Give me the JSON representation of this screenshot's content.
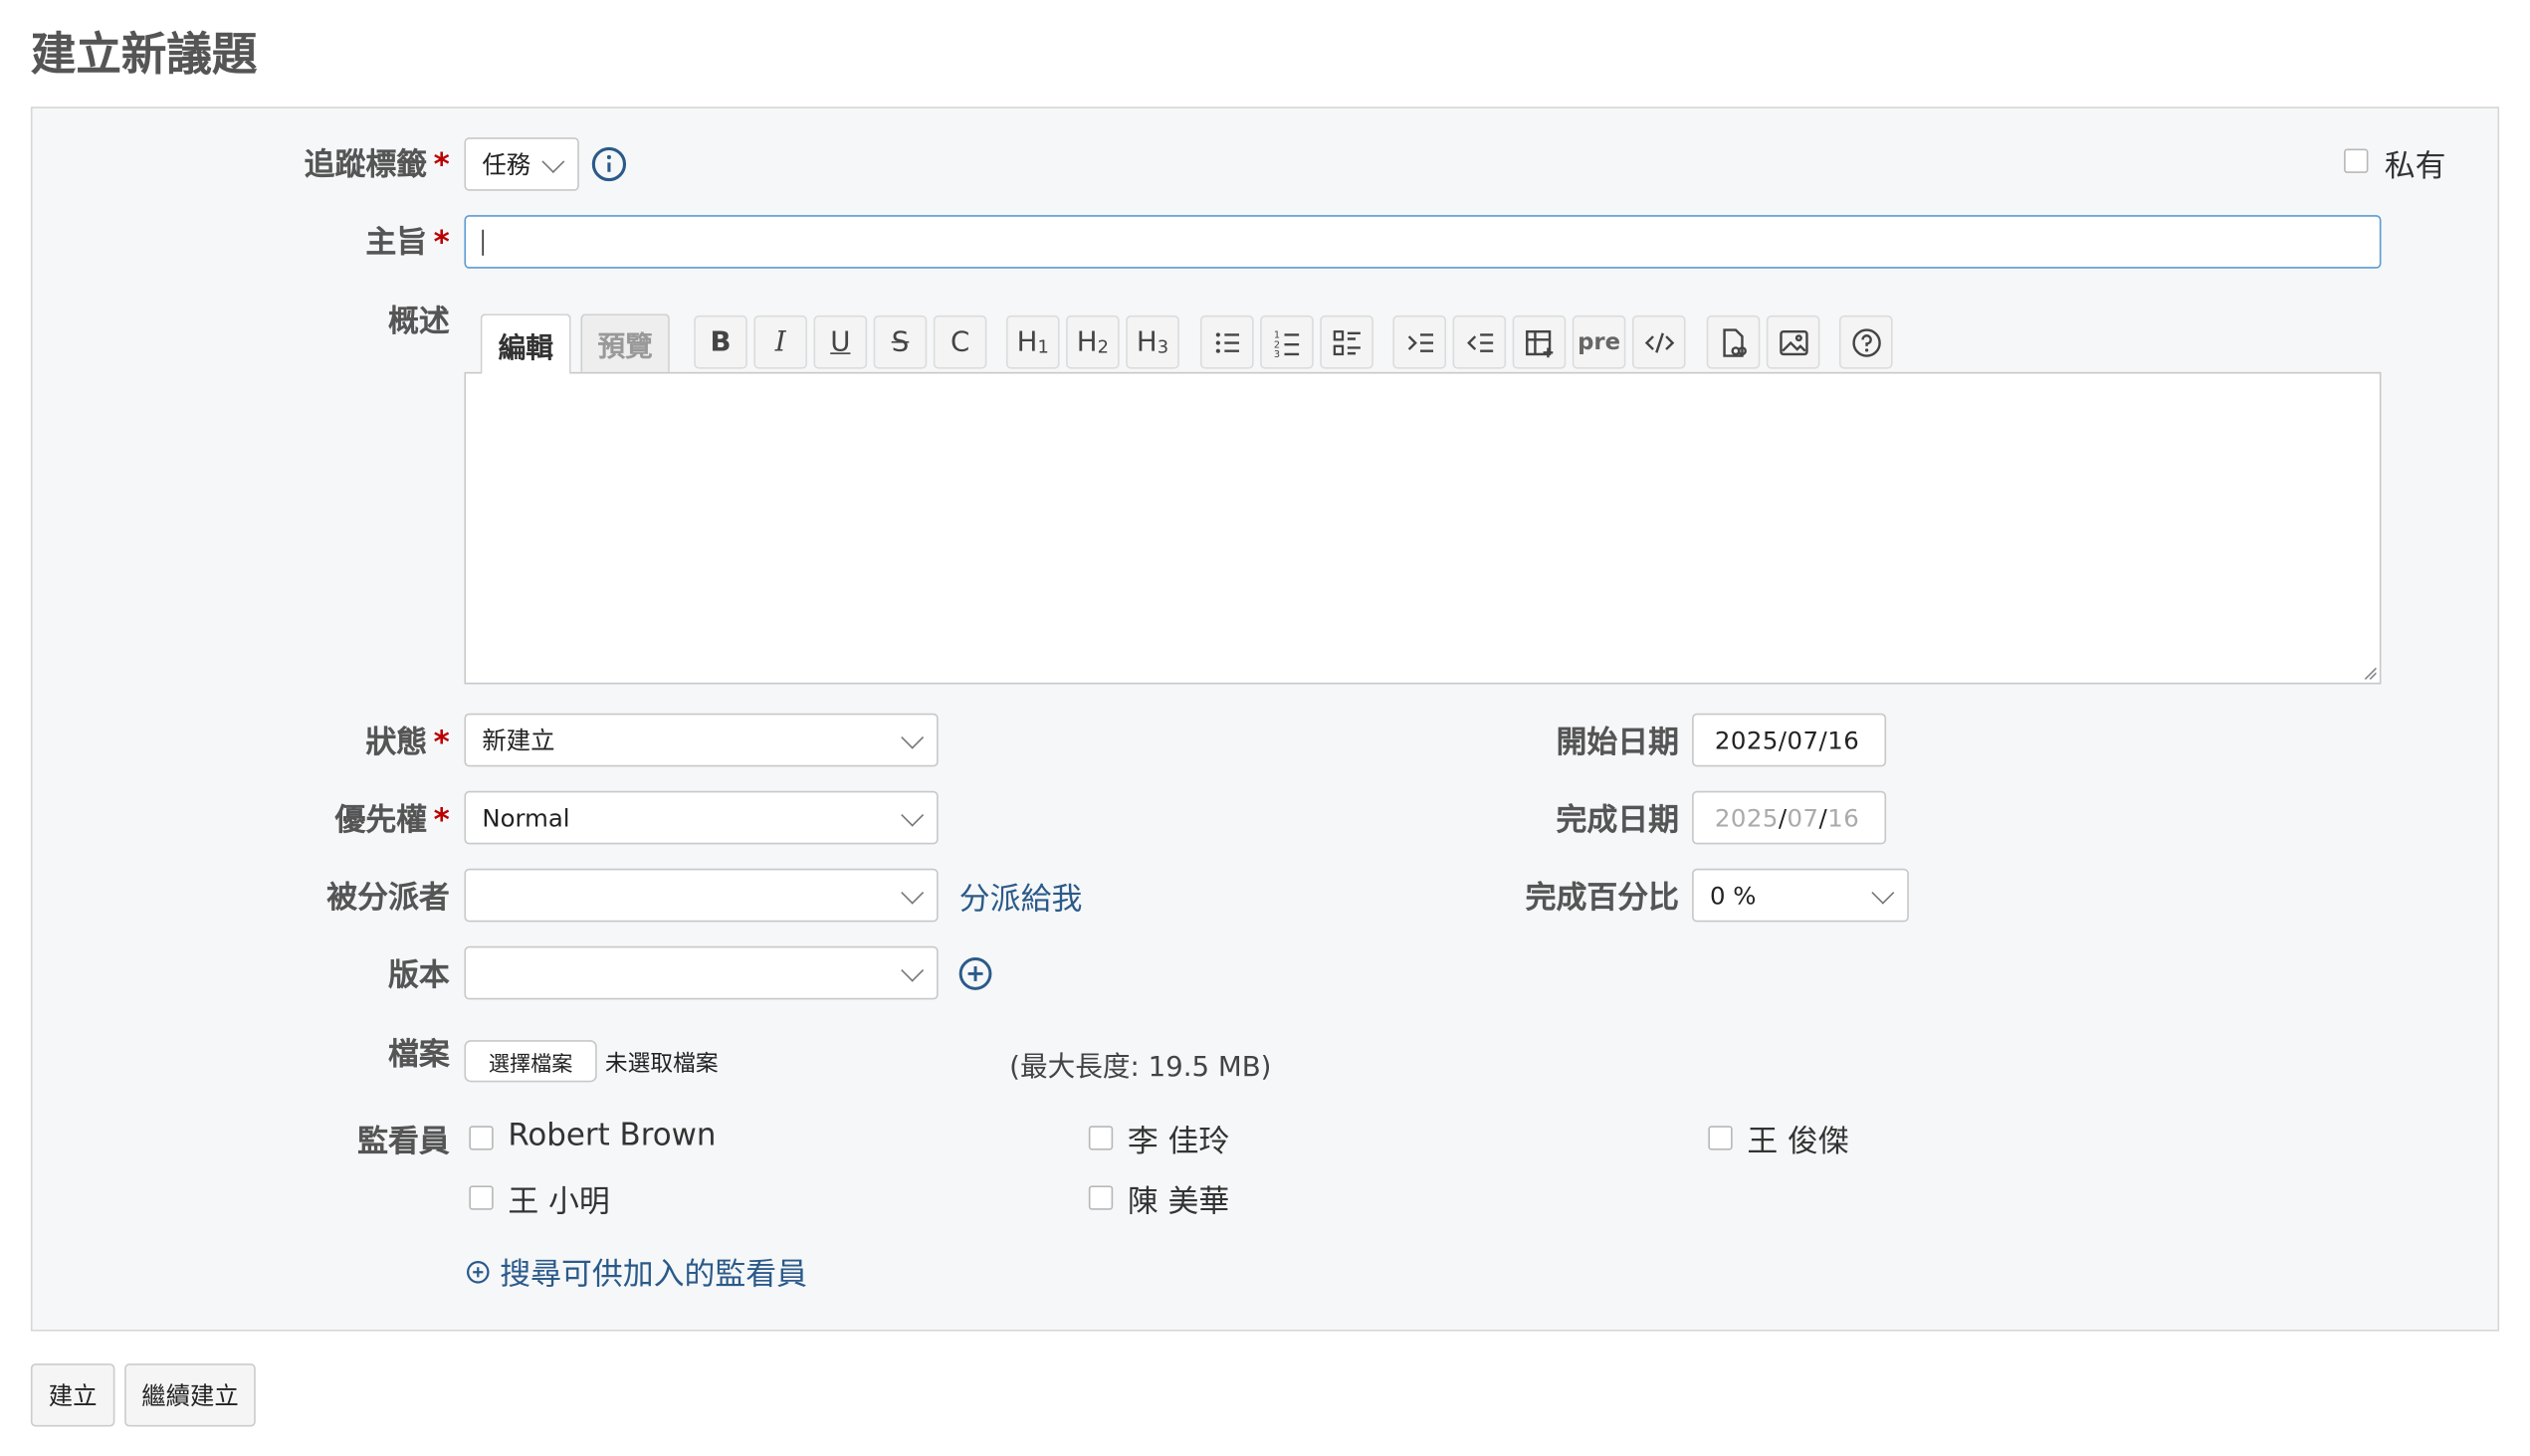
{
  "page": {
    "title": "建立新議題"
  },
  "form": {
    "tracker": {
      "label": "追蹤標籤",
      "value": "任務"
    },
    "private": {
      "label": "私有",
      "checked": false
    },
    "subject": {
      "label": "主旨",
      "value": ""
    },
    "description": {
      "label": "概述",
      "tab_edit": "編輯",
      "tab_preview": "預覽",
      "toolbar": {
        "bold": "B",
        "italic": "I",
        "underline": "U",
        "strike": "S",
        "code": "C",
        "h1": "H",
        "h1_sub": "1",
        "h2": "H",
        "h2_sub": "2",
        "h3": "H",
        "h3_sub": "3",
        "pre": "pre"
      }
    },
    "status": {
      "label": "狀態",
      "value": "新建立"
    },
    "priority": {
      "label": "優先權",
      "value": "Normal"
    },
    "assignee": {
      "label": "被分派者",
      "value": "",
      "assign_to_me": "分派給我"
    },
    "version": {
      "label": "版本",
      "value": ""
    },
    "file": {
      "label": "檔案",
      "choose_button": "選擇檔案",
      "no_file": "未選取檔案",
      "max_size": "(最大長度: 19.5 MB)"
    },
    "watchers": {
      "label": "監看員",
      "list": [
        {
          "name": "Robert Brown",
          "checked": false
        },
        {
          "name": "李 佳玲",
          "checked": false
        },
        {
          "name": "王 俊傑",
          "checked": false
        },
        {
          "name": "王 小明",
          "checked": false
        },
        {
          "name": "陳 美華",
          "checked": false
        }
      ],
      "search_link": "搜尋可供加入的監看員"
    },
    "start_date": {
      "label": "開始日期",
      "value": "2025/07/16"
    },
    "due_date": {
      "label": "完成日期",
      "y": "2025",
      "m": "07",
      "d": "16",
      "sep": "/"
    },
    "done_ratio": {
      "label": "完成百分比",
      "value": "0 %"
    }
  },
  "buttons": {
    "create": "建立",
    "create_continue": "繼續建立"
  },
  "colors": {
    "link": "#2a5a8a",
    "required": "#bb0000",
    "focus_border": "#5b9bd1"
  }
}
